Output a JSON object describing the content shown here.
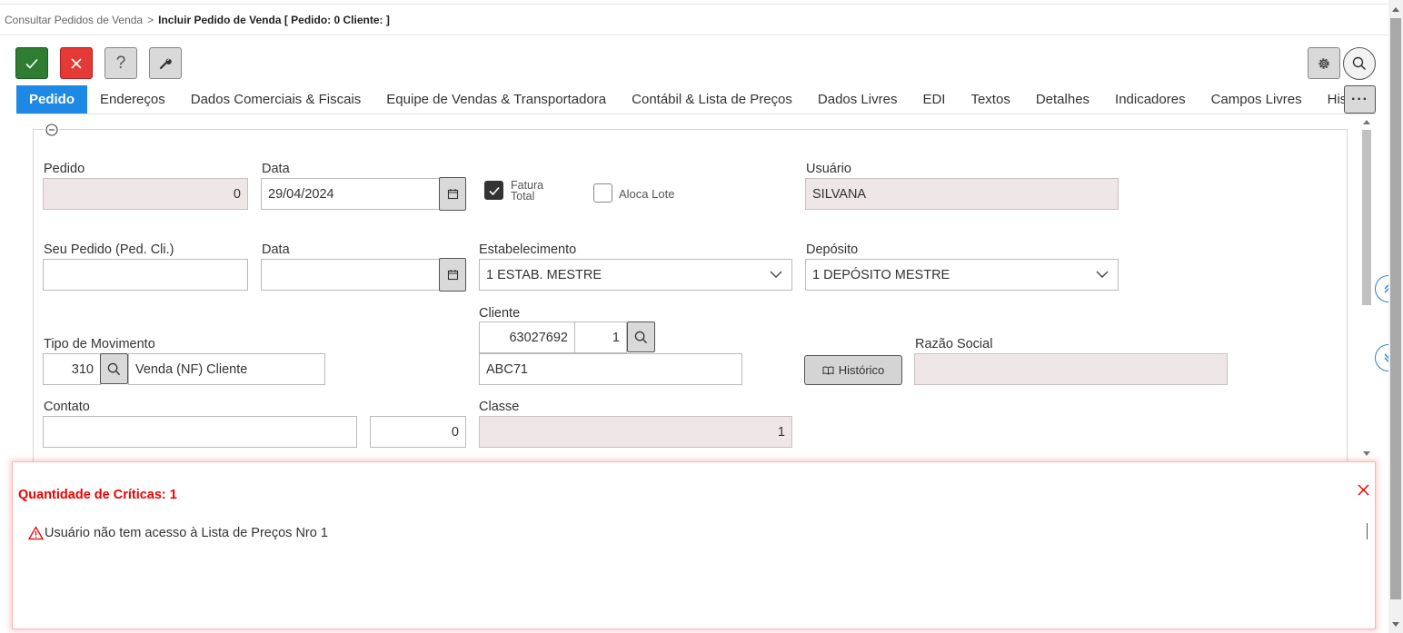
{
  "breadcrumb": {
    "parent": "Consultar Pedidos de Venda",
    "separator": ">",
    "current": "Incluir Pedido de Venda [ Pedido: 0 Cliente: ]"
  },
  "toolbar": {
    "help_label": "?"
  },
  "tabs": [
    {
      "label": "Pedido",
      "active": true
    },
    {
      "label": "Endereços"
    },
    {
      "label": "Dados Comerciais & Fiscais"
    },
    {
      "label": "Equipe de Vendas & Transportadora"
    },
    {
      "label": "Contábil & Lista de Preços"
    },
    {
      "label": "Dados Livres"
    },
    {
      "label": "EDI"
    },
    {
      "label": "Textos"
    },
    {
      "label": "Detalhes"
    },
    {
      "label": "Indicadores"
    },
    {
      "label": "Campos Livres"
    },
    {
      "label": "Histórico de"
    }
  ],
  "tabs_more_label": "···",
  "form": {
    "pedido": {
      "label": "Pedido",
      "value": "0"
    },
    "data": {
      "label": "Data",
      "value": "29/04/2024"
    },
    "fatura_total": {
      "label_line1": "Fatura",
      "label_line2": "Total",
      "checked": true
    },
    "aloca_lote": {
      "label": "Aloca Lote",
      "checked": false
    },
    "usuario": {
      "label": "Usuário",
      "value": "SILVANA"
    },
    "seu_pedido": {
      "label": "Seu Pedido (Ped. Cli.)",
      "value": ""
    },
    "data2": {
      "label": "Data",
      "value": ""
    },
    "estabelecimento": {
      "label": "Estabelecimento",
      "value": "1 ESTAB. MESTRE"
    },
    "deposito": {
      "label": "Depósito",
      "value": "1 DEPÓSITO MESTRE"
    },
    "cliente": {
      "label": "Cliente",
      "code": "63027692",
      "seq": "1",
      "name": "ABC71"
    },
    "tipo_movimento": {
      "label": "Tipo de Movimento",
      "code": "310",
      "description": "Venda (NF) Cliente"
    },
    "historico_button": "Histórico",
    "razao_social": {
      "label": "Razão Social",
      "value": ""
    },
    "contato": {
      "label": "Contato",
      "value": "",
      "number": "0"
    },
    "classe": {
      "label": "Classe",
      "value": "1"
    }
  },
  "critics": {
    "title": "Quantidade de Críticas: 1",
    "message": "Usuário não tem acesso à Lista de Preços Nro 1"
  },
  "colors": {
    "accent_blue": "#1e88e5",
    "ok_green": "#2e7d32",
    "cancel_red": "#e53935",
    "error_red": "#ee0000",
    "readonly_bg": "#efe6e7"
  },
  "icons": [
    "check-icon",
    "close-icon",
    "question-icon",
    "wrench-icon",
    "gear-icon",
    "search-icon",
    "calendar-icon",
    "chevron-down-icon",
    "double-chevron-up-icon",
    "double-chevron-down-icon",
    "minus-circle-icon",
    "book-icon",
    "warning-icon"
  ]
}
